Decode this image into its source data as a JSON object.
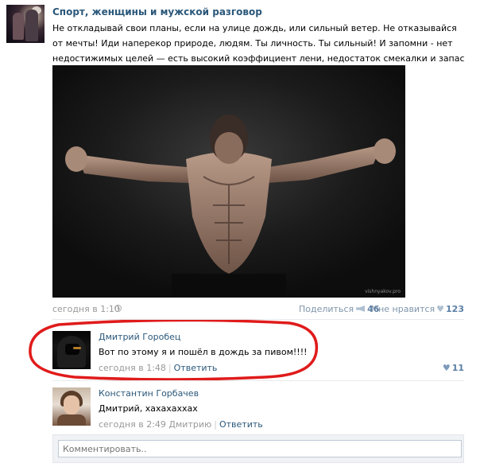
{
  "post": {
    "group_name": "Спорт, женщины и мужской разговор",
    "text": "Не откладывай свои планы, если на улице дождь, или сильный ветер. Не отказывайся от мечты! Иди наперекор природе, людям. Ты личность. Ты сильный! И запомни - нет недостижимых целей — есть высокий коэффициент лени, недостаток смекалки и запас отговорок.",
    "photo_watermark": "vishnyakov.pro",
    "time": "сегодня в 1:10",
    "share_label": "Поделиться",
    "share_count": "46",
    "like_label": "Мне нравится",
    "like_count": "123"
  },
  "comments": [
    {
      "author": "Дмитрий Горобец",
      "text": "Вот по этому я и пошёл в дождь за пивом!!!!",
      "time": "сегодня в 1:48",
      "reply_label": "Ответить",
      "likes": "11"
    },
    {
      "author": "Константин Горбачев",
      "text": "Дмитрий, хахахаххах",
      "time": "сегодня в 2:49 Дмитрию",
      "reply_label": "Ответить"
    }
  ],
  "comment_box": {
    "placeholder": "Комментировать.."
  },
  "icons": {
    "clock": "clock-icon",
    "share": "megaphone-icon",
    "like": "heart-icon"
  },
  "colors": {
    "link": "#2b587a",
    "meta": "#999999",
    "like_count": "#5b7fa6",
    "annotation_red": "#e01b1b"
  }
}
